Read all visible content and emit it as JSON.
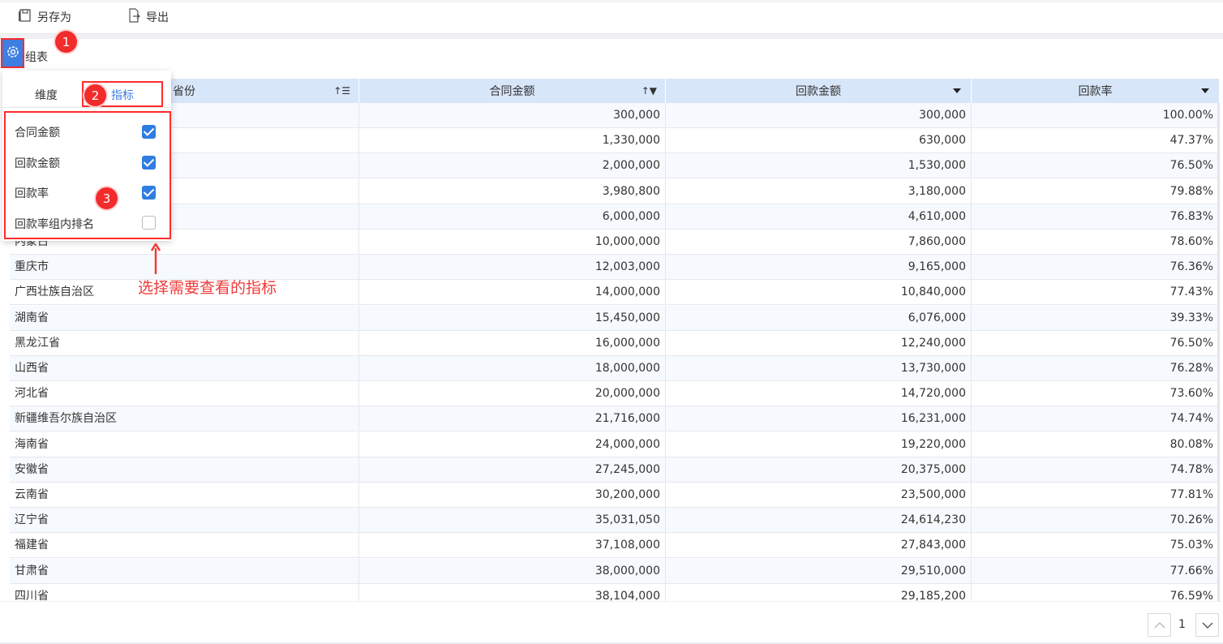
{
  "toolbar": {
    "save_as": "另存为",
    "export": "导出"
  },
  "widget": {
    "title_partial": "组表"
  },
  "table": {
    "headers": [
      "省份",
      "合同金额",
      "回款金额",
      "回款率"
    ],
    "rows": [
      [
        "",
        "300,000",
        "300,000",
        "100.00%"
      ],
      [
        "",
        "1,330,000",
        "630,000",
        "47.37%"
      ],
      [
        "",
        "2,000,000",
        "1,530,000",
        "76.50%"
      ],
      [
        "",
        "3,980,800",
        "3,180,000",
        "79.88%"
      ],
      [
        "",
        "6,000,000",
        "4,610,000",
        "76.83%"
      ],
      [
        "内蒙古",
        "10,000,000",
        "7,860,000",
        "78.60%"
      ],
      [
        "重庆市",
        "12,003,000",
        "9,165,000",
        "76.36%"
      ],
      [
        "广西壮族自治区",
        "14,000,000",
        "10,840,000",
        "77.43%"
      ],
      [
        "湖南省",
        "15,450,000",
        "6,076,000",
        "39.33%"
      ],
      [
        "黑龙江省",
        "16,000,000",
        "12,240,000",
        "76.50%"
      ],
      [
        "山西省",
        "18,000,000",
        "13,730,000",
        "76.28%"
      ],
      [
        "河北省",
        "20,000,000",
        "14,720,000",
        "73.60%"
      ],
      [
        "新疆维吾尔族自治区",
        "21,716,000",
        "16,231,000",
        "74.74%"
      ],
      [
        "海南省",
        "24,000,000",
        "19,220,000",
        "80.08%"
      ],
      [
        "安徽省",
        "27,245,000",
        "20,375,000",
        "74.78%"
      ],
      [
        "云南省",
        "30,200,000",
        "23,500,000",
        "77.81%"
      ],
      [
        "辽宁省",
        "35,031,050",
        "24,614,230",
        "70.26%"
      ],
      [
        "福建省",
        "37,108,000",
        "27,843,000",
        "75.03%"
      ],
      [
        "甘肃省",
        "38,000,000",
        "29,510,000",
        "77.66%"
      ],
      [
        "四川省",
        "38,104,000",
        "29,185,200",
        "76.59%"
      ]
    ]
  },
  "panel": {
    "tab_dimension": "维度",
    "tab_metric": "指标",
    "items": [
      {
        "label": "合同金额",
        "checked": true
      },
      {
        "label": "回款金额",
        "checked": true
      },
      {
        "label": "回款率",
        "checked": true
      },
      {
        "label": "回款率组内排名",
        "checked": false
      }
    ]
  },
  "annotations": {
    "badges": [
      "1",
      "2",
      "3"
    ],
    "note": "选择需要查看的指标",
    "color": "#f03a3a"
  },
  "pagination": {
    "page": "1"
  },
  "colors": {
    "accent": "#3d7ee0",
    "header_bg": "#d8e6fa",
    "highlight": "#ff2d2d"
  }
}
